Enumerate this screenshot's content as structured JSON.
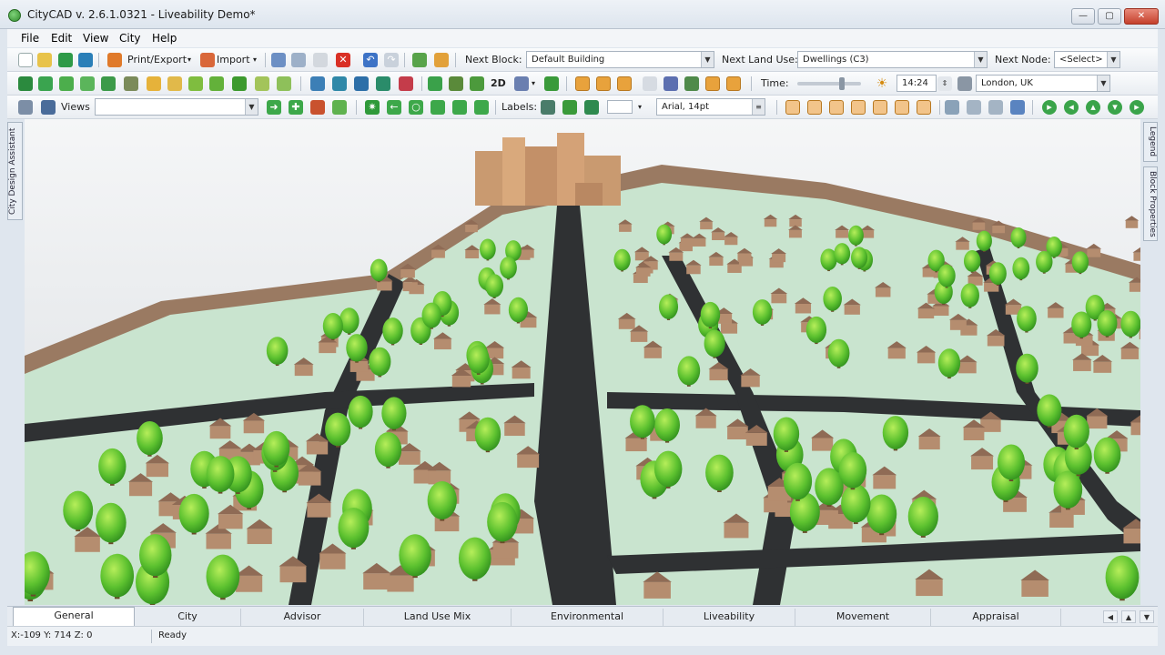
{
  "window": {
    "title": "CityCAD  v. 2.6.1.0321 - Liveability Demo*"
  },
  "menu": {
    "file": "File",
    "edit": "Edit",
    "view": "View",
    "city": "City",
    "help": "Help"
  },
  "toolbar1": {
    "print_export": "Print/Export",
    "import": "Import",
    "next_block_label": "Next Block:",
    "next_block_value": "Default Building",
    "next_land_use_label": "Next Land Use:",
    "next_land_use_value": "Dwellings (C3)",
    "next_node_label": "Next Node:",
    "next_node_value": "<Select>"
  },
  "toolbar2": {
    "mode_2d": "2D",
    "time_label": "Time:",
    "time_value": "14:24",
    "location_value": "London, UK"
  },
  "toolbar3": {
    "views_label": "Views",
    "labels_label": "Labels:",
    "font_value": "Arial, 14pt"
  },
  "side_tabs": {
    "left": "City Design Assistant",
    "right_top": "Legend",
    "right_bottom": "Block Properties"
  },
  "tabs": [
    "General",
    "City",
    "Advisor",
    "Land Use Mix",
    "Environmental",
    "Liveability",
    "Movement",
    "Appraisal"
  ],
  "status": {
    "coords": "X:-109 Y: 714 Z: 0",
    "ready": "Ready"
  },
  "colors": {
    "grass": "#c9e4cf",
    "road": "#2f3133",
    "house_wall": "#b58d6f",
    "house_roof": "#8f6b55",
    "tree": "#6cc23a"
  }
}
